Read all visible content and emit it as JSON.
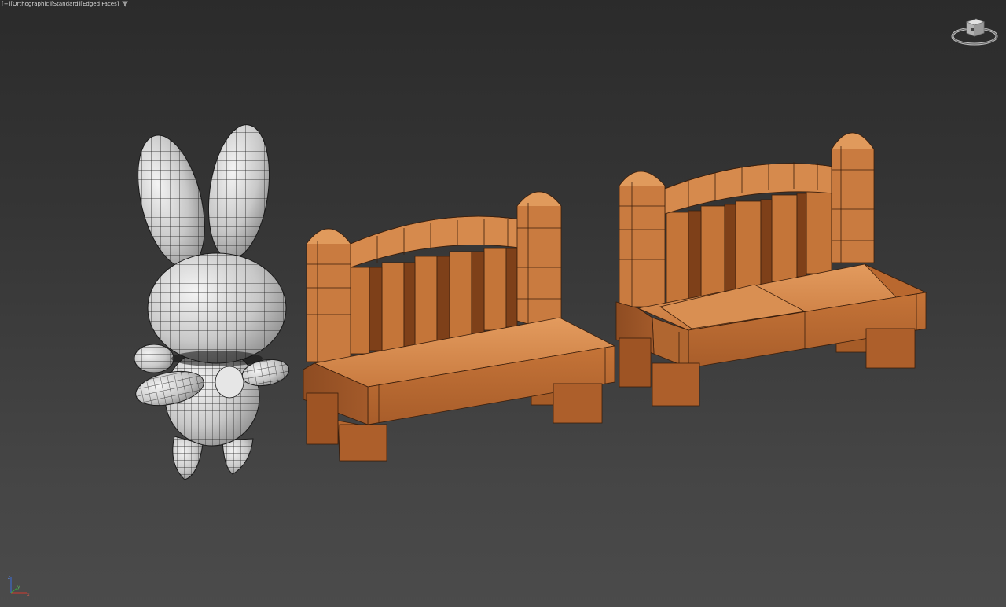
{
  "viewport": {
    "label_plus": "[+]",
    "label_view": "[Orthographic]",
    "label_shading": "[Standard]",
    "label_display": "[Edged Faces]",
    "filter_icon": "funnel-icon"
  },
  "viewcube": {
    "icon": "viewcube-icon"
  },
  "axis": {
    "x": "x",
    "y": "y",
    "z": "z"
  },
  "scene_objects": [
    {
      "name": "bunny",
      "material": "white-gray"
    },
    {
      "name": "bench-small",
      "material": "wood-orange"
    },
    {
      "name": "bench-large",
      "material": "wood-orange"
    }
  ],
  "colors": {
    "background_top": "#2b2b2b",
    "background_bottom": "#4b4b4b",
    "wood": "#c9783e",
    "wood_dark": "#8a4a22",
    "wood_light": "#e39a5c",
    "bunny": "#d9d9d9",
    "bunny_wire": "#1a1a1a"
  }
}
